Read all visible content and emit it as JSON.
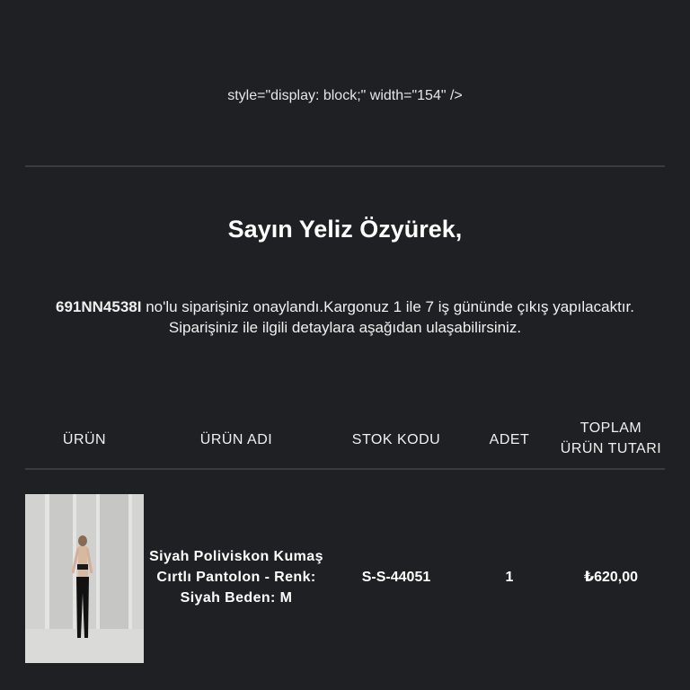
{
  "stray_markup": "style=\"display: block;\" width=\"154\" />",
  "greeting": "Sayın Yeliz Özyürek,",
  "message": {
    "order_number": "691NN4538I",
    "line1_rest": " no'lu siparişiniz onaylandı.Kargonuz 1 ile 7 iş gününde çıkış yapılacaktır.",
    "line2": "Siparişiniz ile ilgili detaylara aşağıdan ulaşabilirsiniz."
  },
  "table": {
    "headers": {
      "product": "ÜRÜN",
      "product_name": "ÜRÜN ADI",
      "stock_code": "STOK KODU",
      "quantity": "ADET",
      "total_line1": "TOPLAM",
      "total_line2": "ÜRÜN TUTARI"
    },
    "rows": [
      {
        "name": "Siyah Poliviskon Kumaş Cırtlı Pantolon - Renk: Siyah Beden: M",
        "stock_code": "S-S-44051",
        "quantity": "1",
        "total": "₺620,00"
      }
    ]
  },
  "colors": {
    "background": "#1f2023",
    "divider": "#3a3b40",
    "text": "#ffffff"
  }
}
